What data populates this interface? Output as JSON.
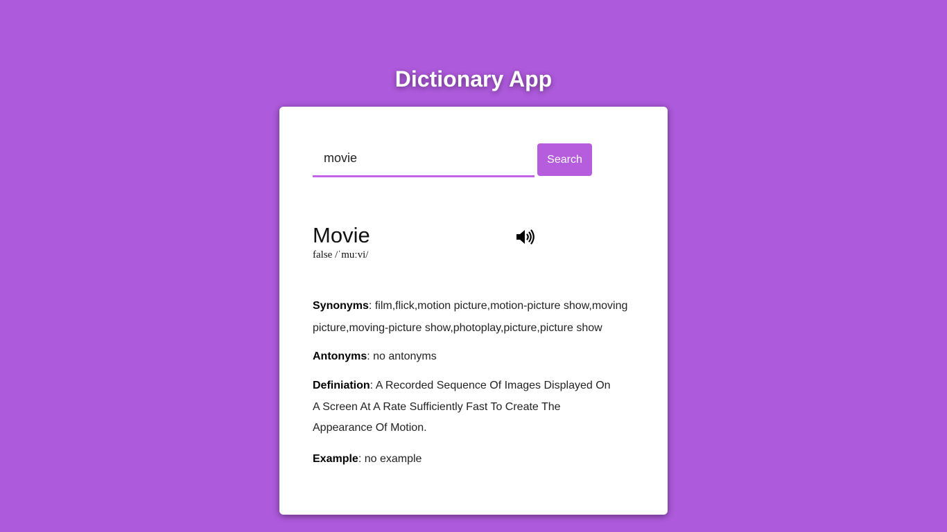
{
  "app": {
    "title": "Dictionary App"
  },
  "search": {
    "value": "movie",
    "placeholder": "",
    "button_label": "Search"
  },
  "result": {
    "word": "Movie",
    "phonetic": "false /ˈmuːvi/",
    "synonyms_label": "Synonyms",
    "synonyms": "film,flick,motion picture,motion-picture show,moving picture,moving-picture show,photoplay,picture,picture show",
    "antonyms_label": "Antonyms",
    "antonyms": "no antonyms",
    "definition_label": "Definiation",
    "definition": "A Recorded Sequence Of Images Displayed On A Screen At A Rate Sufficiently Fast To Create The Appearance Of Motion.",
    "example_label": "Example",
    "example": "no example",
    "separator": ": "
  },
  "icons": {
    "audio": "speaker-icon"
  },
  "colors": {
    "background": "#ae5adc",
    "accent": "#b55ddc",
    "input_underline": "#c264e8",
    "card": "#ffffff"
  }
}
